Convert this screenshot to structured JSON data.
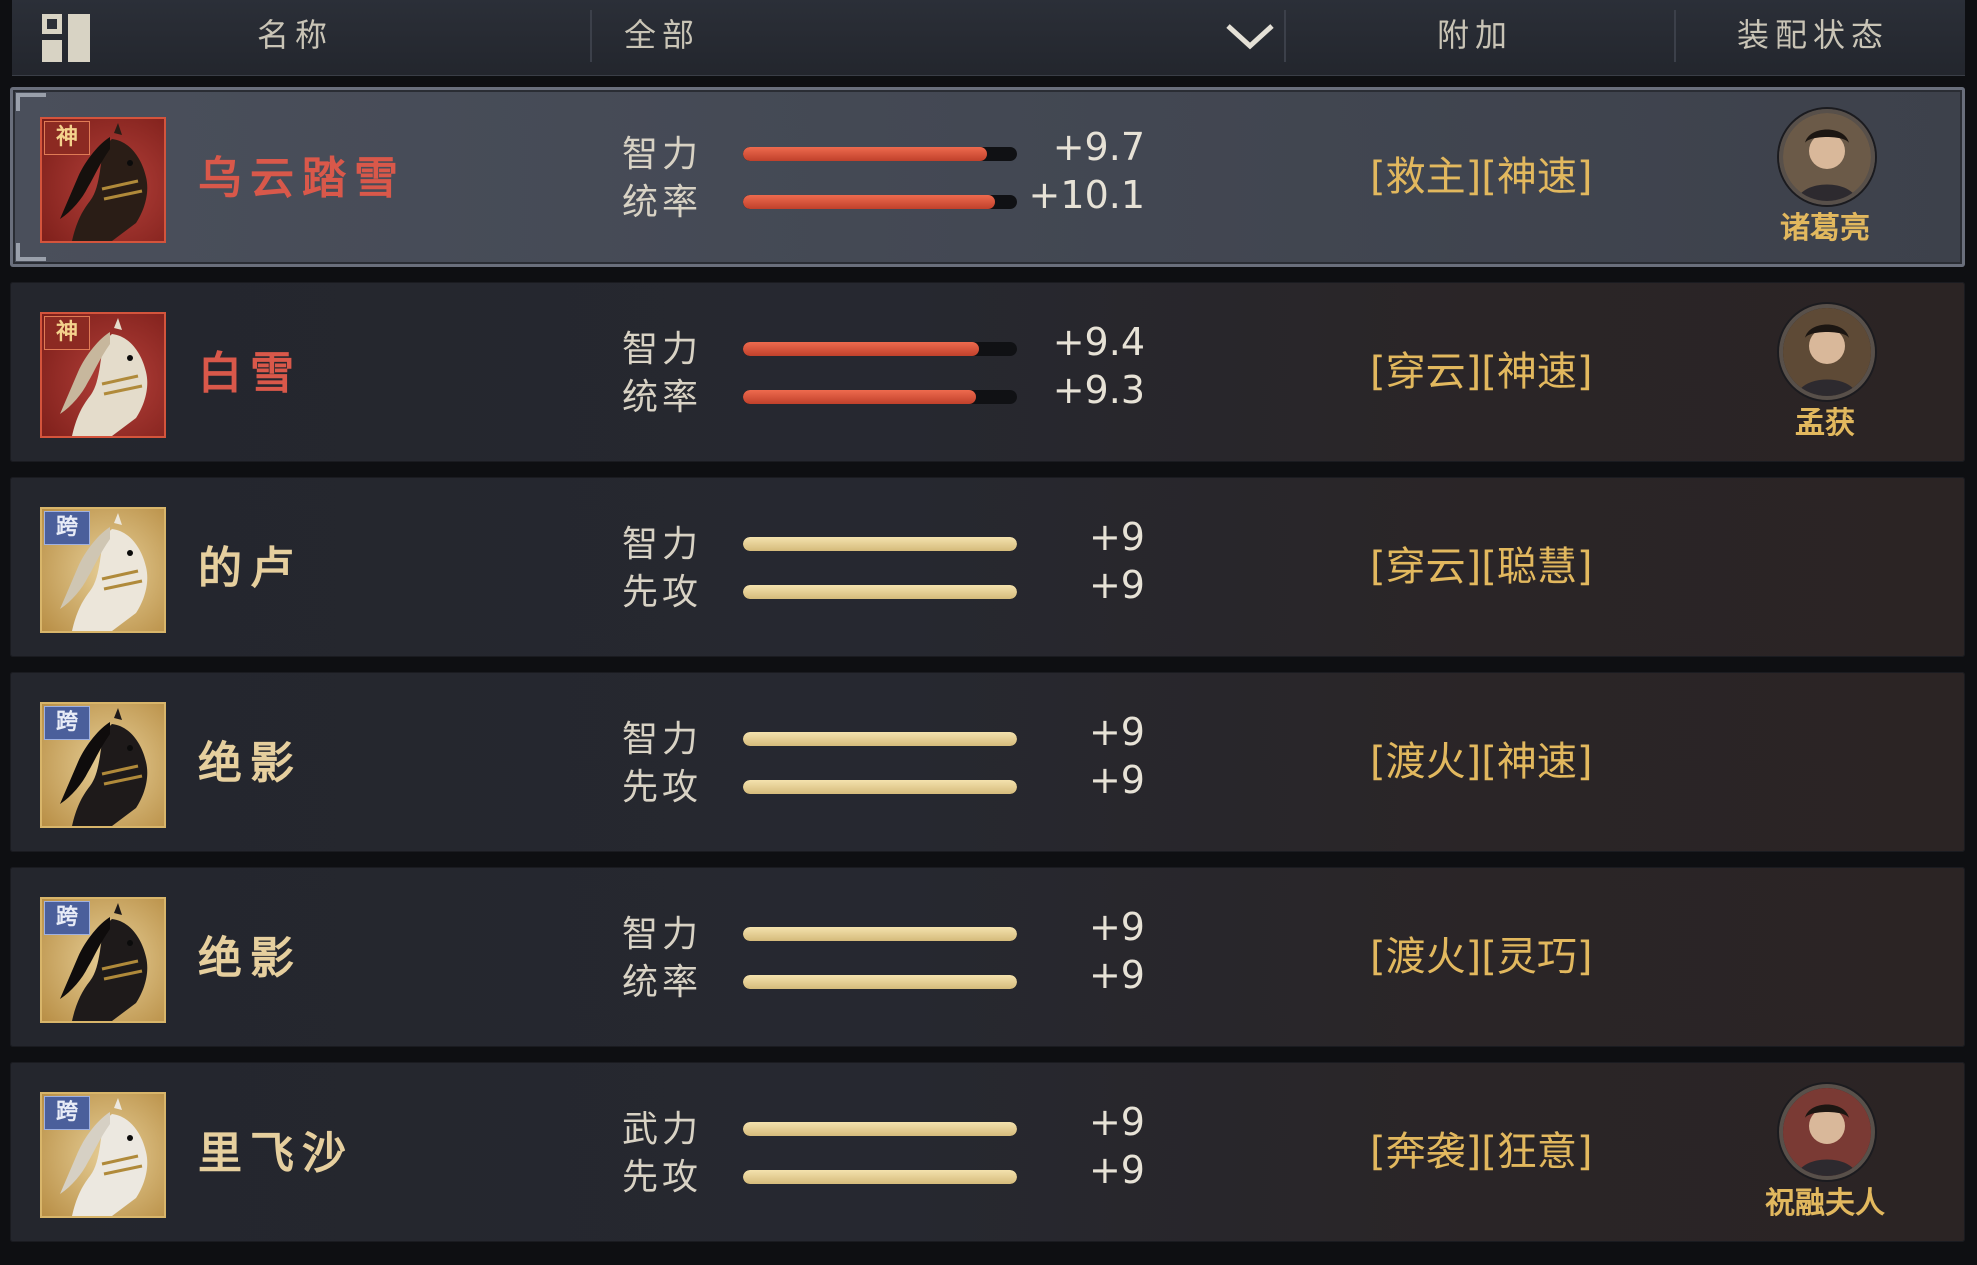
{
  "header": {
    "name_col": "名称",
    "filter_value": "全部",
    "bonus_col": "附加",
    "equip_col": "装配状态"
  },
  "rows": [
    {
      "tier": "神",
      "tier_kind": "shen",
      "name": "乌云踏雪",
      "name_color": "red",
      "selected": true,
      "horse_color": "#2a1d16",
      "mane_color": "#15100d",
      "stats": [
        {
          "label": "智力",
          "value": "+9.7",
          "fill": 0.89,
          "bar": "red"
        },
        {
          "label": "统率",
          "value": "+10.1",
          "fill": 0.92,
          "bar": "red"
        }
      ],
      "bonus": "[救主][神速]",
      "general": "诸葛亮",
      "avatar_color": "#6b5a48"
    },
    {
      "tier": "神",
      "tier_kind": "shen",
      "name": "白雪",
      "name_color": "red",
      "selected": false,
      "horse_color": "#e4dccb",
      "mane_color": "#c7b79d",
      "stats": [
        {
          "label": "智力",
          "value": "+9.4",
          "fill": 0.86,
          "bar": "red"
        },
        {
          "label": "统率",
          "value": "+9.3",
          "fill": 0.85,
          "bar": "red"
        }
      ],
      "bonus": "[穿云][神速]",
      "general": "孟获",
      "avatar_color": "#5e4a36"
    },
    {
      "tier": "跨",
      "tier_kind": "kua",
      "name": "的卢",
      "name_color": "gold",
      "selected": false,
      "horse_color": "#ece6da",
      "mane_color": "#cfc6b3",
      "stats": [
        {
          "label": "智力",
          "value": "+9",
          "fill": 1.0,
          "bar": "gold"
        },
        {
          "label": "先攻",
          "value": "+9",
          "fill": 1.0,
          "bar": "gold"
        }
      ],
      "bonus": "[穿云][聪慧]",
      "general": "",
      "avatar_color": ""
    },
    {
      "tier": "跨",
      "tier_kind": "kua",
      "name": "绝影",
      "name_color": "gold",
      "selected": false,
      "horse_color": "#1e1a1a",
      "mane_color": "#0f0c0c",
      "stats": [
        {
          "label": "智力",
          "value": "+9",
          "fill": 1.0,
          "bar": "gold"
        },
        {
          "label": "先攻",
          "value": "+9",
          "fill": 1.0,
          "bar": "gold"
        }
      ],
      "bonus": "[渡火][神速]",
      "general": "",
      "avatar_color": ""
    },
    {
      "tier": "跨",
      "tier_kind": "kua",
      "name": "绝影",
      "name_color": "gold",
      "selected": false,
      "horse_color": "#1e1a1a",
      "mane_color": "#0f0c0c",
      "stats": [
        {
          "label": "智力",
          "value": "+9",
          "fill": 1.0,
          "bar": "gold"
        },
        {
          "label": "统率",
          "value": "+9",
          "fill": 1.0,
          "bar": "gold"
        }
      ],
      "bonus": "[渡火][灵巧]",
      "general": "",
      "avatar_color": ""
    },
    {
      "tier": "跨",
      "tier_kind": "kua",
      "name": "里飞沙",
      "name_color": "gold",
      "selected": false,
      "horse_color": "#ece8e0",
      "mane_color": "#d6d0c4",
      "stats": [
        {
          "label": "武力",
          "value": "+9",
          "fill": 1.0,
          "bar": "gold"
        },
        {
          "label": "先攻",
          "value": "+9",
          "fill": 1.0,
          "bar": "gold"
        }
      ],
      "bonus": "[奔袭][狂意]",
      "general": "祝融夫人",
      "avatar_color": "#7a3a34"
    }
  ]
}
